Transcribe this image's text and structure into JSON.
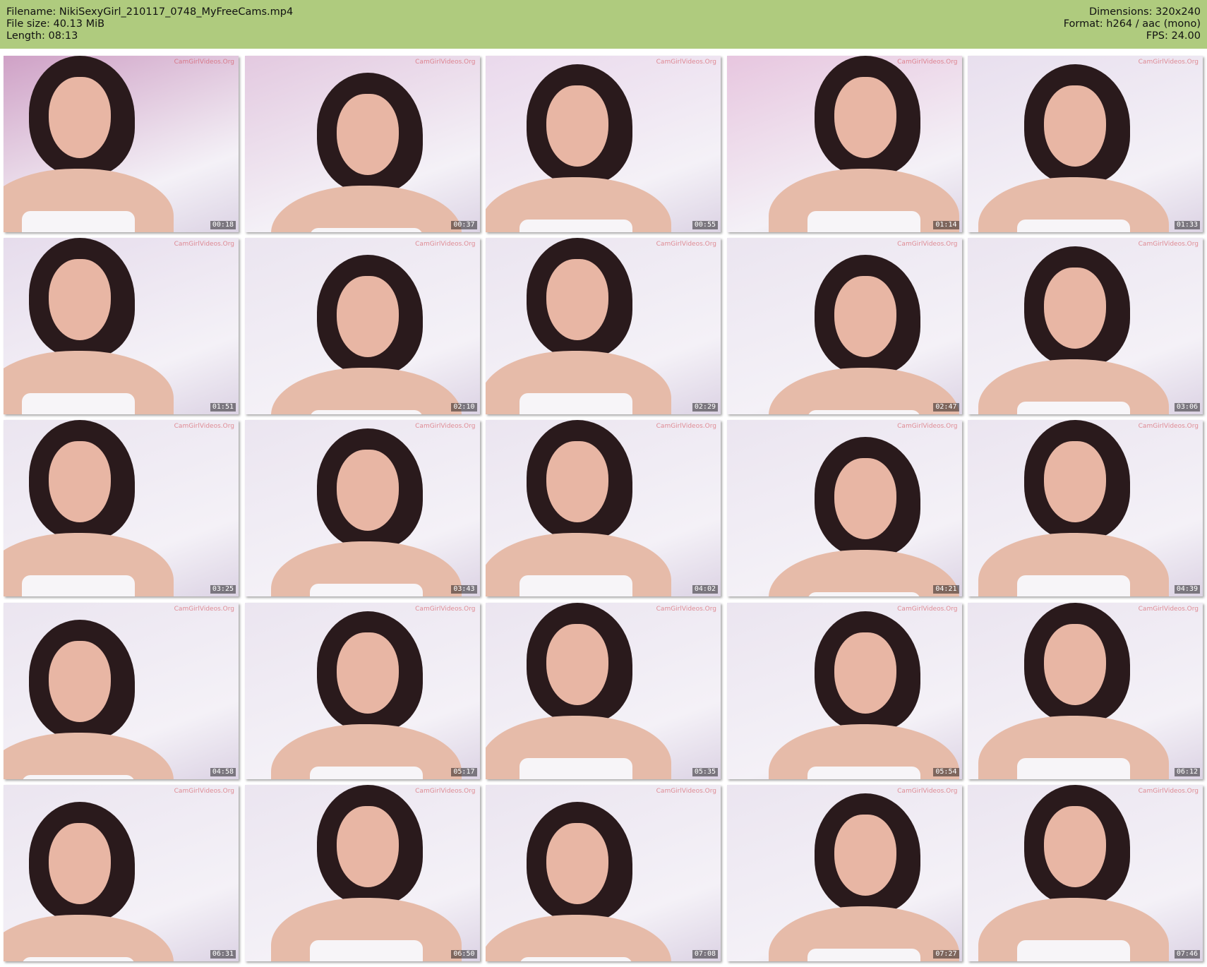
{
  "header": {
    "filename_label": "Filename: NikiSexyGirl_210117_0748_MyFreeCams.mp4",
    "filesize_label": "File size: 40.13 MiB",
    "length_label": "Length: 08:13",
    "dimensions_label": "Dimensions: 320x240",
    "format_label": "Format: h264 / aac (mono)",
    "fps_label": "FPS: 24.00"
  },
  "colors": {
    "header_bg": "#afcb7e",
    "wall_lilac": "#e9e2ef",
    "wall_pink": "#d9a7c8"
  },
  "thumbnails": [
    {
      "time": "00:18",
      "wall": "#cfa1c6",
      "watermark": "CamGirlVideos.Org"
    },
    {
      "time": "00:37",
      "wall": "#e3c9e0",
      "watermark": "CamGirlVideos.Org"
    },
    {
      "time": "00:55",
      "wall": "#ead9ec",
      "watermark": "CamGirlVideos.Org"
    },
    {
      "time": "01:14",
      "wall": "#e7c6df",
      "watermark": "CamGirlVideos.Org"
    },
    {
      "time": "01:33",
      "wall": "#e8dfee",
      "watermark": "CamGirlVideos.Org"
    },
    {
      "time": "01:51",
      "wall": "#e6dcec",
      "watermark": "CamGirlVideos.Org"
    },
    {
      "time": "02:10",
      "wall": "#ebe5f0",
      "watermark": "CamGirlVideos.Org"
    },
    {
      "time": "02:29",
      "wall": "#ebe5f0",
      "watermark": "CamGirlVideos.Org"
    },
    {
      "time": "02:47",
      "wall": "#ebe5f0",
      "watermark": "CamGirlVideos.Org"
    },
    {
      "time": "03:06",
      "wall": "#ebe5f0",
      "watermark": "CamGirlVideos.Org"
    },
    {
      "time": "03:25",
      "wall": "#ebe5f0",
      "watermark": "CamGirlVideos.Org"
    },
    {
      "time": "03:43",
      "wall": "#ebe5f0",
      "watermark": "CamGirlVideos.Org"
    },
    {
      "time": "04:02",
      "wall": "#ebe5f0",
      "watermark": "CamGirlVideos.Org"
    },
    {
      "time": "04:21",
      "wall": "#ebe5f0",
      "watermark": "CamGirlVideos.Org"
    },
    {
      "time": "04:39",
      "wall": "#ebe5f0",
      "watermark": "CamGirlVideos.Org"
    },
    {
      "time": "04:58",
      "wall": "#ebe5f0",
      "watermark": "CamGirlVideos.Org"
    },
    {
      "time": "05:17",
      "wall": "#ebe5f0",
      "watermark": "CamGirlVideos.Org"
    },
    {
      "time": "05:35",
      "wall": "#ebe5f0",
      "watermark": "CamGirlVideos.Org"
    },
    {
      "time": "05:54",
      "wall": "#ebe5f0",
      "watermark": "CamGirlVideos.Org"
    },
    {
      "time": "06:12",
      "wall": "#ebe5f0",
      "watermark": "CamGirlVideos.Org"
    },
    {
      "time": "06:31",
      "wall": "#ebe5f0",
      "watermark": "CamGirlVideos.Org"
    },
    {
      "time": "06:50",
      "wall": "#ebe5f0",
      "watermark": "CamGirlVideos.Org"
    },
    {
      "time": "07:08",
      "wall": "#ebe5f0",
      "watermark": "CamGirlVideos.Org"
    },
    {
      "time": "07:27",
      "wall": "#ebe5f0",
      "watermark": "CamGirlVideos.Org"
    },
    {
      "time": "07:46",
      "wall": "#ebe5f0",
      "watermark": "CamGirlVideos.Org"
    }
  ]
}
